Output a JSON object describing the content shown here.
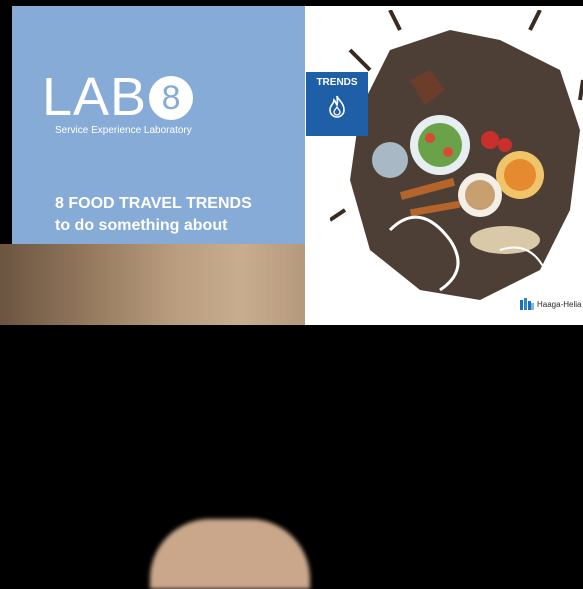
{
  "logo": {
    "word": "LAB",
    "number": "8",
    "subtitle": "Service Experience Laboratory"
  },
  "headline": {
    "line1": "8 FOOD TRAVEL TRENDS",
    "line2": "to do something about"
  },
  "badge": {
    "label": "TRENDS",
    "icon": "flame-icon"
  },
  "brand": {
    "name": "Haaga-Helia"
  },
  "colors": {
    "panel": "#86abd7",
    "badge": "#1f5fa8",
    "white": "#ffffff"
  }
}
